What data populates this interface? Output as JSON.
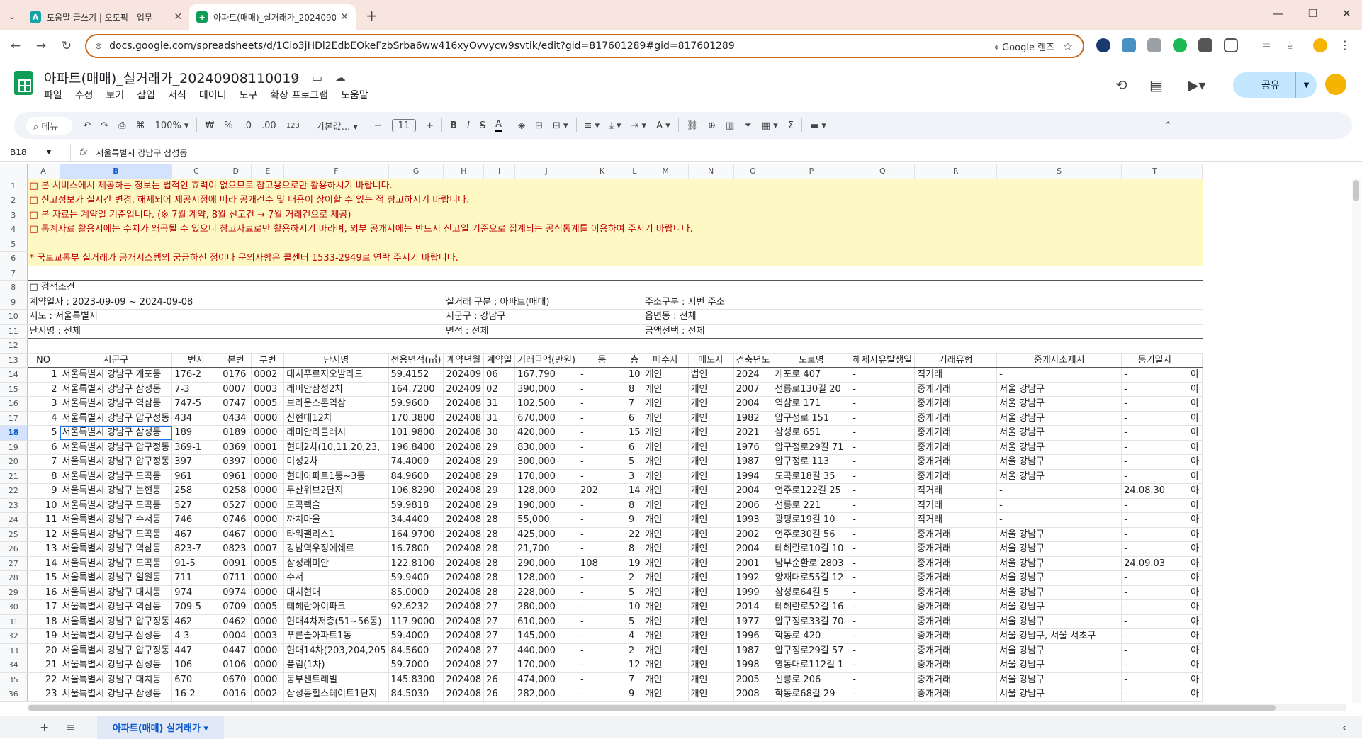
{
  "browser": {
    "tabs": [
      {
        "title": "도움말 글쓰기 | 오토픽 - 업무",
        "icon": "A"
      },
      {
        "title": "아파트(매매)_실거래가_20240908",
        "icon": "+"
      }
    ],
    "url": "docs.google.com/spreadsheets/d/1Cio3jHDl2EdbEOkeFzbSrba6ww416xyOvvycw9svtik/edit?gid=817601289#gid=817601289",
    "lens_label": "Google 렌즈"
  },
  "doc": {
    "title": "아파트(매매)_실거래가_20240908110019",
    "menu": [
      "파일",
      "수정",
      "보기",
      "삽입",
      "서식",
      "데이터",
      "도구",
      "확장 프로그램",
      "도움말"
    ],
    "share_label": "공유"
  },
  "toolbar": {
    "search": "메뉴",
    "zoom": "100%",
    "currency": "₩",
    "percent": "%",
    "dec_minus": ".0",
    "dec_plus": ".00",
    "number_format": "123",
    "font": "기본값...",
    "font_size": "11"
  },
  "formula": {
    "namebox": "B18",
    "fx": "fx",
    "content": "서울특별시 강남구 삼성동"
  },
  "columns": [
    "A",
    "B",
    "C",
    "D",
    "E",
    "F",
    "G",
    "H",
    "I",
    "J",
    "K",
    "L",
    "M",
    "N",
    "O",
    "P",
    "Q",
    "R",
    "S",
    "T"
  ],
  "notices": [
    "□ 본 서비스에서 제공하는 정보는 법적인 효력이 없으므로 참고용으로만 활용하시기 바랍니다.",
    "□ 신고정보가 실시간 변경, 해제되어 제공시점에 따라 공개건수 및 내용이 상이할 수 있는 점 참고하시기 바랍니다.",
    "□ 본 자료는 계약일 기준입니다. (※ 7월 계약, 8월 신고건 → 7월 거래건으로   제공)",
    "□ 통계자료 활용시에는 수치가 왜곡될 수 있으니 참고자료로만 활용하시기   바라며,  외부 공개시에는 반드시 신고일 기준으로 집계되는 공식통계를 이용하여 주시기 바랍니다.",
    "",
    "* 국토교통부 실거래가 공개시스템의 궁금하신 점이나 문의사항은 콜센터 1533-2949로 연락 주시기 바랍니다."
  ],
  "search_conditions": {
    "title": "□ 검색조건",
    "r9": [
      "계약일자 : 2023-09-09 ~ 2024-09-08",
      "실거래 구분 : 아파트(매매)",
      "주소구분 : 지번 주소"
    ],
    "r10": [
      "시도 : 서울특별시",
      "시군구 : 강남구",
      "읍면동 : 전체"
    ],
    "r11": [
      "단지명 : 전체",
      "면적 : 전체",
      "금액선택 : 전체"
    ]
  },
  "table_headers": [
    "NO",
    "시군구",
    "번지",
    "본번",
    "부번",
    "단지명",
    "전용면적(㎡)",
    "계약년월",
    "계약일",
    "거래금액(만원)",
    "동",
    "층",
    "매수자",
    "매도자",
    "건축년도",
    "도로명",
    "해제사유발생일",
    "거래유형",
    "중개사소재지",
    "등기일자"
  ],
  "table_rows": [
    [
      "1",
      "서울특별시 강남구 개포동",
      "176-2",
      "0176",
      "0002",
      "대치푸르지오발라드",
      "59.4152",
      "202409",
      "06",
      "167,790",
      "-",
      "10",
      "개인",
      "법인",
      "2024",
      "개포로 407",
      "-",
      "직거래",
      "-",
      "-"
    ],
    [
      "2",
      "서울특별시 강남구 삼성동",
      "7-3",
      "0007",
      "0003",
      "래미안삼성2차",
      "164.7200",
      "202409",
      "02",
      "390,000",
      "-",
      "8",
      "개인",
      "개인",
      "2007",
      "선릉로130길 20",
      "-",
      "중개거래",
      "서울 강남구",
      "-"
    ],
    [
      "3",
      "서울특별시 강남구 역삼동",
      "747-5",
      "0747",
      "0005",
      "브라운스톤역삼",
      "59.9600",
      "202408",
      "31",
      "102,500",
      "-",
      "7",
      "개인",
      "개인",
      "2004",
      "역삼로 171",
      "-",
      "중개거래",
      "서울 강남구",
      "-"
    ],
    [
      "4",
      "서울특별시 강남구 압구정동",
      "434",
      "0434",
      "0000",
      "신현대12차",
      "170.3800",
      "202408",
      "31",
      "670,000",
      "-",
      "6",
      "개인",
      "개인",
      "1982",
      "압구정로 151",
      "-",
      "중개거래",
      "서울 강남구",
      "-"
    ],
    [
      "5",
      "서울특별시 강남구 삼성동",
      "189",
      "0189",
      "0000",
      "래미안라클래시",
      "101.9800",
      "202408",
      "30",
      "420,000",
      "-",
      "15",
      "개인",
      "개인",
      "2021",
      "삼성로 651",
      "-",
      "중개거래",
      "서울 강남구",
      "-"
    ],
    [
      "6",
      "서울특별시 강남구 압구정동",
      "369-1",
      "0369",
      "0001",
      "현대2차(10,11,20,23,",
      "196.8400",
      "202408",
      "29",
      "830,000",
      "-",
      "6",
      "개인",
      "개인",
      "1976",
      "압구정로29길 71",
      "-",
      "중개거래",
      "서울 강남구",
      "-"
    ],
    [
      "7",
      "서울특별시 강남구 압구정동",
      "397",
      "0397",
      "0000",
      "미성2차",
      "74.4000",
      "202408",
      "29",
      "300,000",
      "-",
      "5",
      "개인",
      "개인",
      "1987",
      "압구정로 113",
      "-",
      "중개거래",
      "서울 강남구",
      "-"
    ],
    [
      "8",
      "서울특별시 강남구 도곡동",
      "961",
      "0961",
      "0000",
      "현대아파트1동~3동",
      "84.9600",
      "202408",
      "29",
      "170,000",
      "-",
      "3",
      "개인",
      "개인",
      "1994",
      "도곡로18길 35",
      "-",
      "중개거래",
      "서울 강남구",
      "-"
    ],
    [
      "9",
      "서울특별시 강남구 논현동",
      "258",
      "0258",
      "0000",
      "두산위브2단지",
      "106.8290",
      "202408",
      "29",
      "128,000",
      "202",
      "14",
      "개인",
      "개인",
      "2004",
      "언주로122길 25",
      "-",
      "직거래",
      "-",
      "24.08.30"
    ],
    [
      "10",
      "서울특별시 강남구 도곡동",
      "527",
      "0527",
      "0000",
      "도곡렉슬",
      "59.9818",
      "202408",
      "29",
      "190,000",
      "-",
      "8",
      "개인",
      "개인",
      "2006",
      "선릉로 221",
      "-",
      "직거래",
      "-",
      "-"
    ],
    [
      "11",
      "서울특별시 강남구 수서동",
      "746",
      "0746",
      "0000",
      "까치마을",
      "34.4400",
      "202408",
      "28",
      "55,000",
      "-",
      "9",
      "개인",
      "개인",
      "1993",
      "광평로19길 10",
      "-",
      "직거래",
      "-",
      "-"
    ],
    [
      "12",
      "서울특별시 강남구 도곡동",
      "467",
      "0467",
      "0000",
      "타워팰리스1",
      "164.9700",
      "202408",
      "28",
      "425,000",
      "-",
      "22",
      "개인",
      "개인",
      "2002",
      "언주로30길 56",
      "-",
      "중개거래",
      "서울 강남구",
      "-"
    ],
    [
      "13",
      "서울특별시 강남구 역삼동",
      "823-7",
      "0823",
      "0007",
      "강남역우정에쉐르",
      "16.7800",
      "202408",
      "28",
      "21,700",
      "-",
      "8",
      "개인",
      "개인",
      "2004",
      "테헤란로10길 10",
      "-",
      "중개거래",
      "서울 강남구",
      "-"
    ],
    [
      "14",
      "서울특별시 강남구 도곡동",
      "91-5",
      "0091",
      "0005",
      "삼성래미안",
      "122.8100",
      "202408",
      "28",
      "290,000",
      "108",
      "19",
      "개인",
      "개인",
      "2001",
      "남부순환로 2803",
      "-",
      "중개거래",
      "서울 강남구",
      "24.09.03"
    ],
    [
      "15",
      "서울특별시 강남구 일원동",
      "711",
      "0711",
      "0000",
      "수서",
      "59.9400",
      "202408",
      "28",
      "128,000",
      "-",
      "2",
      "개인",
      "개인",
      "1992",
      "양재대로55길 12",
      "-",
      "중개거래",
      "서울 강남구",
      "-"
    ],
    [
      "16",
      "서울특별시 강남구 대치동",
      "974",
      "0974",
      "0000",
      "대치현대",
      "85.0000",
      "202408",
      "28",
      "228,000",
      "-",
      "5",
      "개인",
      "개인",
      "1999",
      "삼성로64길 5",
      "-",
      "중개거래",
      "서울 강남구",
      "-"
    ],
    [
      "17",
      "서울특별시 강남구 역삼동",
      "709-5",
      "0709",
      "0005",
      "테헤란아이파크",
      "92.6232",
      "202408",
      "27",
      "280,000",
      "-",
      "10",
      "개인",
      "개인",
      "2014",
      "테헤란로52길 16",
      "-",
      "중개거래",
      "서울 강남구",
      "-"
    ],
    [
      "18",
      "서울특별시 강남구 압구정동",
      "462",
      "0462",
      "0000",
      "현대4차저층(51~56동)",
      "117.9000",
      "202408",
      "27",
      "610,000",
      "-",
      "5",
      "개인",
      "개인",
      "1977",
      "압구정로33길 70",
      "-",
      "중개거래",
      "서울 강남구",
      "-"
    ],
    [
      "19",
      "서울특별시 강남구 삼성동",
      "4-3",
      "0004",
      "0003",
      "푸른솔아파트1동",
      "59.4000",
      "202408",
      "27",
      "145,000",
      "-",
      "4",
      "개인",
      "개인",
      "1996",
      "학동로 420",
      "-",
      "중개거래",
      "서울 강남구, 서울 서초구",
      "-"
    ],
    [
      "20",
      "서울특별시 강남구 압구정동",
      "447",
      "0447",
      "0000",
      "현대14차(203,204,205",
      "84.5600",
      "202408",
      "27",
      "440,000",
      "-",
      "2",
      "개인",
      "개인",
      "1987",
      "압구정로29길 57",
      "-",
      "중개거래",
      "서울 강남구",
      "-"
    ],
    [
      "21",
      "서울특별시 강남구 삼성동",
      "106",
      "0106",
      "0000",
      "풍림(1차)",
      "59.7000",
      "202408",
      "27",
      "170,000",
      "-",
      "12",
      "개인",
      "개인",
      "1998",
      "영동대로112길 1",
      "-",
      "중개거래",
      "서울 강남구",
      "-"
    ],
    [
      "22",
      "서울특별시 강남구 대치동",
      "670",
      "0670",
      "0000",
      "동부센트레빌",
      "145.8300",
      "202408",
      "26",
      "474,000",
      "-",
      "7",
      "개인",
      "개인",
      "2005",
      "선릉로 206",
      "-",
      "중개거래",
      "서울 강남구",
      "-"
    ],
    [
      "23",
      "서울특별시 강남구 삼성동",
      "16-2",
      "0016",
      "0002",
      "삼성동힐스테이트1단지",
      "84.5030",
      "202408",
      "26",
      "282,000",
      "-",
      "9",
      "개인",
      "개인",
      "2008",
      "학동로68길 29",
      "-",
      "중개거래",
      "서울 강남구",
      "-"
    ]
  ],
  "sheet_tab": "아파트(매매) 실거래가"
}
